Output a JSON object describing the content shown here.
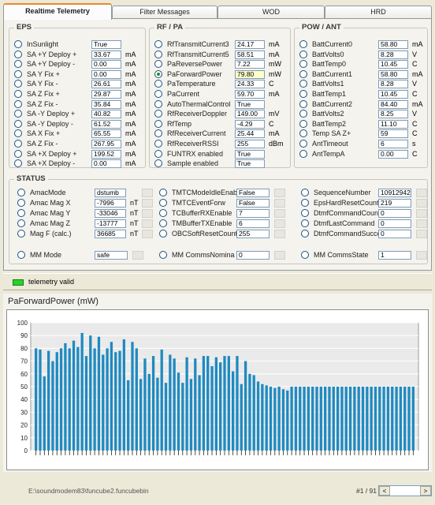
{
  "tabs": [
    "Realtime Telemetry",
    "Filter Messages",
    "WOD",
    "HRD"
  ],
  "eps": {
    "title": "EPS",
    "rows": [
      {
        "label": "InSunlight",
        "value": "True",
        "unit": ""
      },
      {
        "label": "SA +Y Deploy +",
        "value": "33.67",
        "unit": "mA"
      },
      {
        "label": "SA +Y Deploy -",
        "value": "0.00",
        "unit": "mA"
      },
      {
        "label": "SA Y Fix +",
        "value": "0.00",
        "unit": "mA"
      },
      {
        "label": "SA Y Fix -",
        "value": "26.61",
        "unit": "mA"
      },
      {
        "label": "SA Z Fix +",
        "value": "29.87",
        "unit": "mA"
      },
      {
        "label": "SA Z Fix -",
        "value": "35.84",
        "unit": "mA"
      },
      {
        "label": "SA -Y Deploy +",
        "value": "40.82",
        "unit": "mA"
      },
      {
        "label": "SA -Y Deploy -",
        "value": "61.52",
        "unit": "mA"
      },
      {
        "label": "SA X Fix +",
        "value": "65.55",
        "unit": "mA"
      },
      {
        "label": "SA Z Fix -",
        "value": "267.95",
        "unit": "mA"
      },
      {
        "label": "SA +X Deploy +",
        "value": "199.52",
        "unit": "mA"
      },
      {
        "label": "SA +X Deploy -",
        "value": "0.00",
        "unit": "mA"
      }
    ]
  },
  "rf": {
    "title": "RF / PA",
    "rows": [
      {
        "label": "RfTransmitCurrent3",
        "value": "24.17",
        "unit": "mA"
      },
      {
        "label": "RfTransmitCurrent5",
        "value": "58.51",
        "unit": "mA"
      },
      {
        "label": "PaReversePower",
        "value": "7.22",
        "unit": "mW"
      },
      {
        "label": "PaForwardPower",
        "value": "79.80",
        "unit": "mW",
        "checked": true,
        "highlight": true
      },
      {
        "label": "PaTemperature",
        "value": "24.33",
        "unit": "C"
      },
      {
        "label": "PaCurrent",
        "value": "59.70",
        "unit": "mA"
      },
      {
        "label": "AutoThermalControl",
        "value": "True",
        "unit": ""
      },
      {
        "label": "RfReceiverDoppler",
        "value": "149.00",
        "unit": "mV"
      },
      {
        "label": "RfTemp",
        "value": "-4.29",
        "unit": "C"
      },
      {
        "label": "RfReceiverCurrent",
        "value": "25.44",
        "unit": "mA"
      },
      {
        "label": "RfReceiverRSSI",
        "value": "255",
        "unit": "dBm"
      },
      {
        "label": "FUNTRX enabled",
        "value": "True",
        "unit": ""
      },
      {
        "label": "Sample enabled",
        "value": "True",
        "unit": ""
      }
    ]
  },
  "pow": {
    "title": "POW / ANT",
    "rows": [
      {
        "label": "BattCurrent0",
        "value": "58.80",
        "unit": "mA"
      },
      {
        "label": "BattVolts0",
        "value": "8.28",
        "unit": "V"
      },
      {
        "label": "BattTemp0",
        "value": "10.45",
        "unit": "C"
      },
      {
        "label": "BattCurrent1",
        "value": "58.80",
        "unit": "mA"
      },
      {
        "label": "BattVolts1",
        "value": "8.28",
        "unit": "V"
      },
      {
        "label": "BattTemp1",
        "value": "10.45",
        "unit": "C"
      },
      {
        "label": "BattCurrent2",
        "value": "84.40",
        "unit": "mA"
      },
      {
        "label": "BattVolts2",
        "value": "8.25",
        "unit": "V"
      },
      {
        "label": "BattTemp2",
        "value": "11.10",
        "unit": "C"
      },
      {
        "label": "Temp SA Z+",
        "value": "59",
        "unit": "C"
      },
      {
        "label": "AntTimeout",
        "value": "6",
        "unit": "s"
      },
      {
        "label": "AntTempA",
        "value": "0.00",
        "unit": "C"
      }
    ]
  },
  "status": {
    "title": "STATUS",
    "col1": [
      {
        "label": "AmacMode",
        "value": "dstumb",
        "unit": ""
      },
      {
        "label": "Amac Mag X",
        "value": "-7996",
        "unit": "nT"
      },
      {
        "label": "Amac Mag Y",
        "value": "-33046",
        "unit": "nT"
      },
      {
        "label": "Amac Mag Z",
        "value": "-13777",
        "unit": "nT"
      },
      {
        "label": "Mag F (calc.)",
        "value": "36685",
        "unit": "nT"
      }
    ],
    "col2": [
      {
        "label": "TMTCModeIdleEnab",
        "value": "False"
      },
      {
        "label": "TMTCEventForw",
        "value": "False"
      },
      {
        "label": "TCBufferRXEnable",
        "value": "7"
      },
      {
        "label": "TMBufferTXEnable",
        "value": "6"
      },
      {
        "label": "OBCSoftResetCount",
        "value": "255"
      }
    ],
    "col3": [
      {
        "label": "SequenceNumber",
        "value": "10912942"
      },
      {
        "label": "EpsHardResetCount",
        "value": "219"
      },
      {
        "label": "DtmfCommandCount",
        "value": "0"
      },
      {
        "label": "DtmfLastCommand",
        "value": "0"
      },
      {
        "label": "DtmfCommandSucce",
        "value": "0"
      }
    ],
    "bottom": [
      {
        "label": "MM Mode",
        "value": "safe"
      },
      {
        "label": "MM CommsNominal",
        "value": "0"
      },
      {
        "label": "MM CommsState",
        "value": "1"
      }
    ]
  },
  "telemetry_valid": "telemetry valid",
  "colors": {
    "bar": "#1f8ac0",
    "led": "#27d327",
    "accent": "#e68b2c"
  },
  "chart_data": {
    "type": "bar",
    "title": "PaForwardPower (mW)",
    "ylim": [
      0,
      100
    ],
    "yticks": [
      0,
      10,
      20,
      30,
      40,
      50,
      60,
      70,
      80,
      90,
      100
    ],
    "grid": true,
    "values": [
      80,
      79,
      58,
      78,
      70,
      77,
      80,
      84,
      80,
      86,
      81,
      92,
      74,
      90,
      80,
      89,
      75,
      80,
      85,
      77,
      78,
      87,
      55,
      85,
      80,
      56,
      72,
      60,
      74,
      57,
      79,
      53,
      75,
      72,
      61,
      53,
      73,
      56,
      72,
      59,
      74,
      74,
      66,
      73,
      69,
      74,
      74,
      62,
      74,
      52,
      70,
      60,
      59,
      54,
      52,
      51,
      50,
      49,
      50,
      48,
      47,
      50,
      50,
      50,
      50,
      50,
      50,
      50,
      50,
      50,
      50,
      50,
      50,
      50,
      50,
      50,
      50,
      50,
      50,
      50,
      50,
      50,
      50,
      50,
      50,
      50,
      50,
      50,
      50,
      50,
      50
    ]
  },
  "footer": {
    "path": "E:\\soundmodem83\\funcube2.funcubebin",
    "page": "#1 / 91",
    "left_arrow": "<",
    "right_arrow": ">"
  }
}
